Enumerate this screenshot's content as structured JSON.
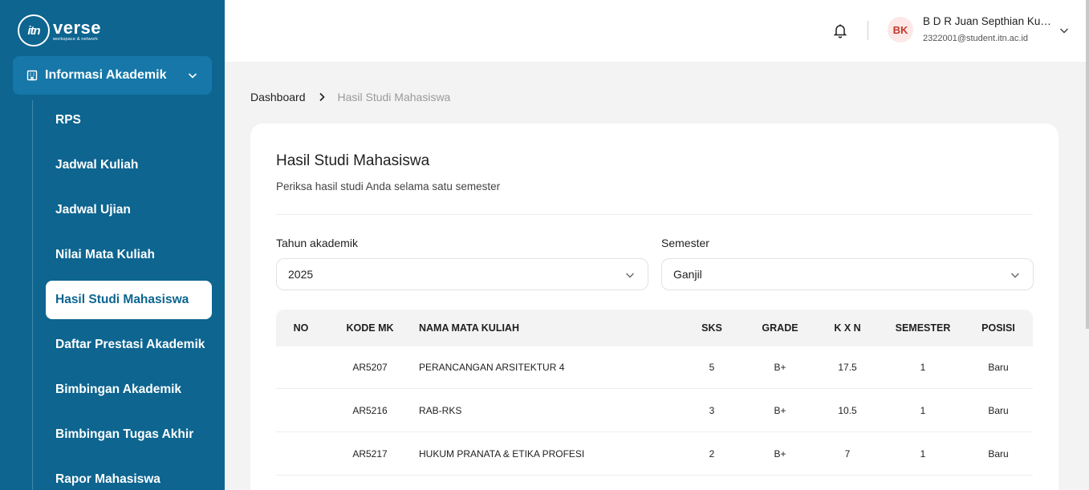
{
  "brand": {
    "logo_mark": "itn",
    "name": "verse",
    "tagline": "workspace & network"
  },
  "sidebar": {
    "group": {
      "icon": "building-icon",
      "label": "Informasi Akademik"
    },
    "items": [
      {
        "label": "RPS",
        "active": false
      },
      {
        "label": "Jadwal Kuliah",
        "active": false
      },
      {
        "label": "Jadwal Ujian",
        "active": false
      },
      {
        "label": "Nilai Mata Kuliah",
        "active": false
      },
      {
        "label": "Hasil Studi Mahasiswa",
        "active": true
      },
      {
        "label": "Daftar Prestasi Akademik",
        "active": false
      },
      {
        "label": "Bimbingan Akademik",
        "active": false
      },
      {
        "label": "Bimbingan Tugas Akhir",
        "active": false
      },
      {
        "label": "Rapor Mahasiswa",
        "active": false
      }
    ]
  },
  "header": {
    "user": {
      "initials": "BK",
      "name": "B D R Juan Septhian Kurniawan",
      "email": "2322001@student.itn.ac.id"
    }
  },
  "breadcrumb": {
    "home": "Dashboard",
    "current": "Hasil Studi Mahasiswa"
  },
  "card": {
    "title": "Hasil Studi Mahasiswa",
    "description": "Periksa hasil studi Anda selama satu semester",
    "filters": {
      "year": {
        "label": "Tahun akademik",
        "value": "2025"
      },
      "semester": {
        "label": "Semester",
        "value": "Ganjil"
      }
    },
    "table": {
      "headers": [
        "NO",
        "KODE MK",
        "NAMA MATA KULIAH",
        "SKS",
        "GRADE",
        "K X N",
        "SEMESTER",
        "POSISI"
      ],
      "rows": [
        [
          "",
          "AR5207",
          "PERANCANGAN ARSITEKTUR 4",
          "5",
          "B+",
          "17.5",
          "1",
          "Baru"
        ],
        [
          "",
          "AR5216",
          "RAB-RKS",
          "3",
          "B+",
          "10.5",
          "1",
          "Baru"
        ],
        [
          "",
          "AR5217",
          "HUKUM PRANATA & ETIKA PROFESI",
          "2",
          "B+",
          "7",
          "1",
          "Baru"
        ]
      ]
    }
  },
  "colors": {
    "sidebar_bg": "#0d6590",
    "group_bg": "#1677a8",
    "accent": "#0d6590",
    "avatar_bg": "#fde7e7",
    "avatar_text": "#c0392b"
  }
}
